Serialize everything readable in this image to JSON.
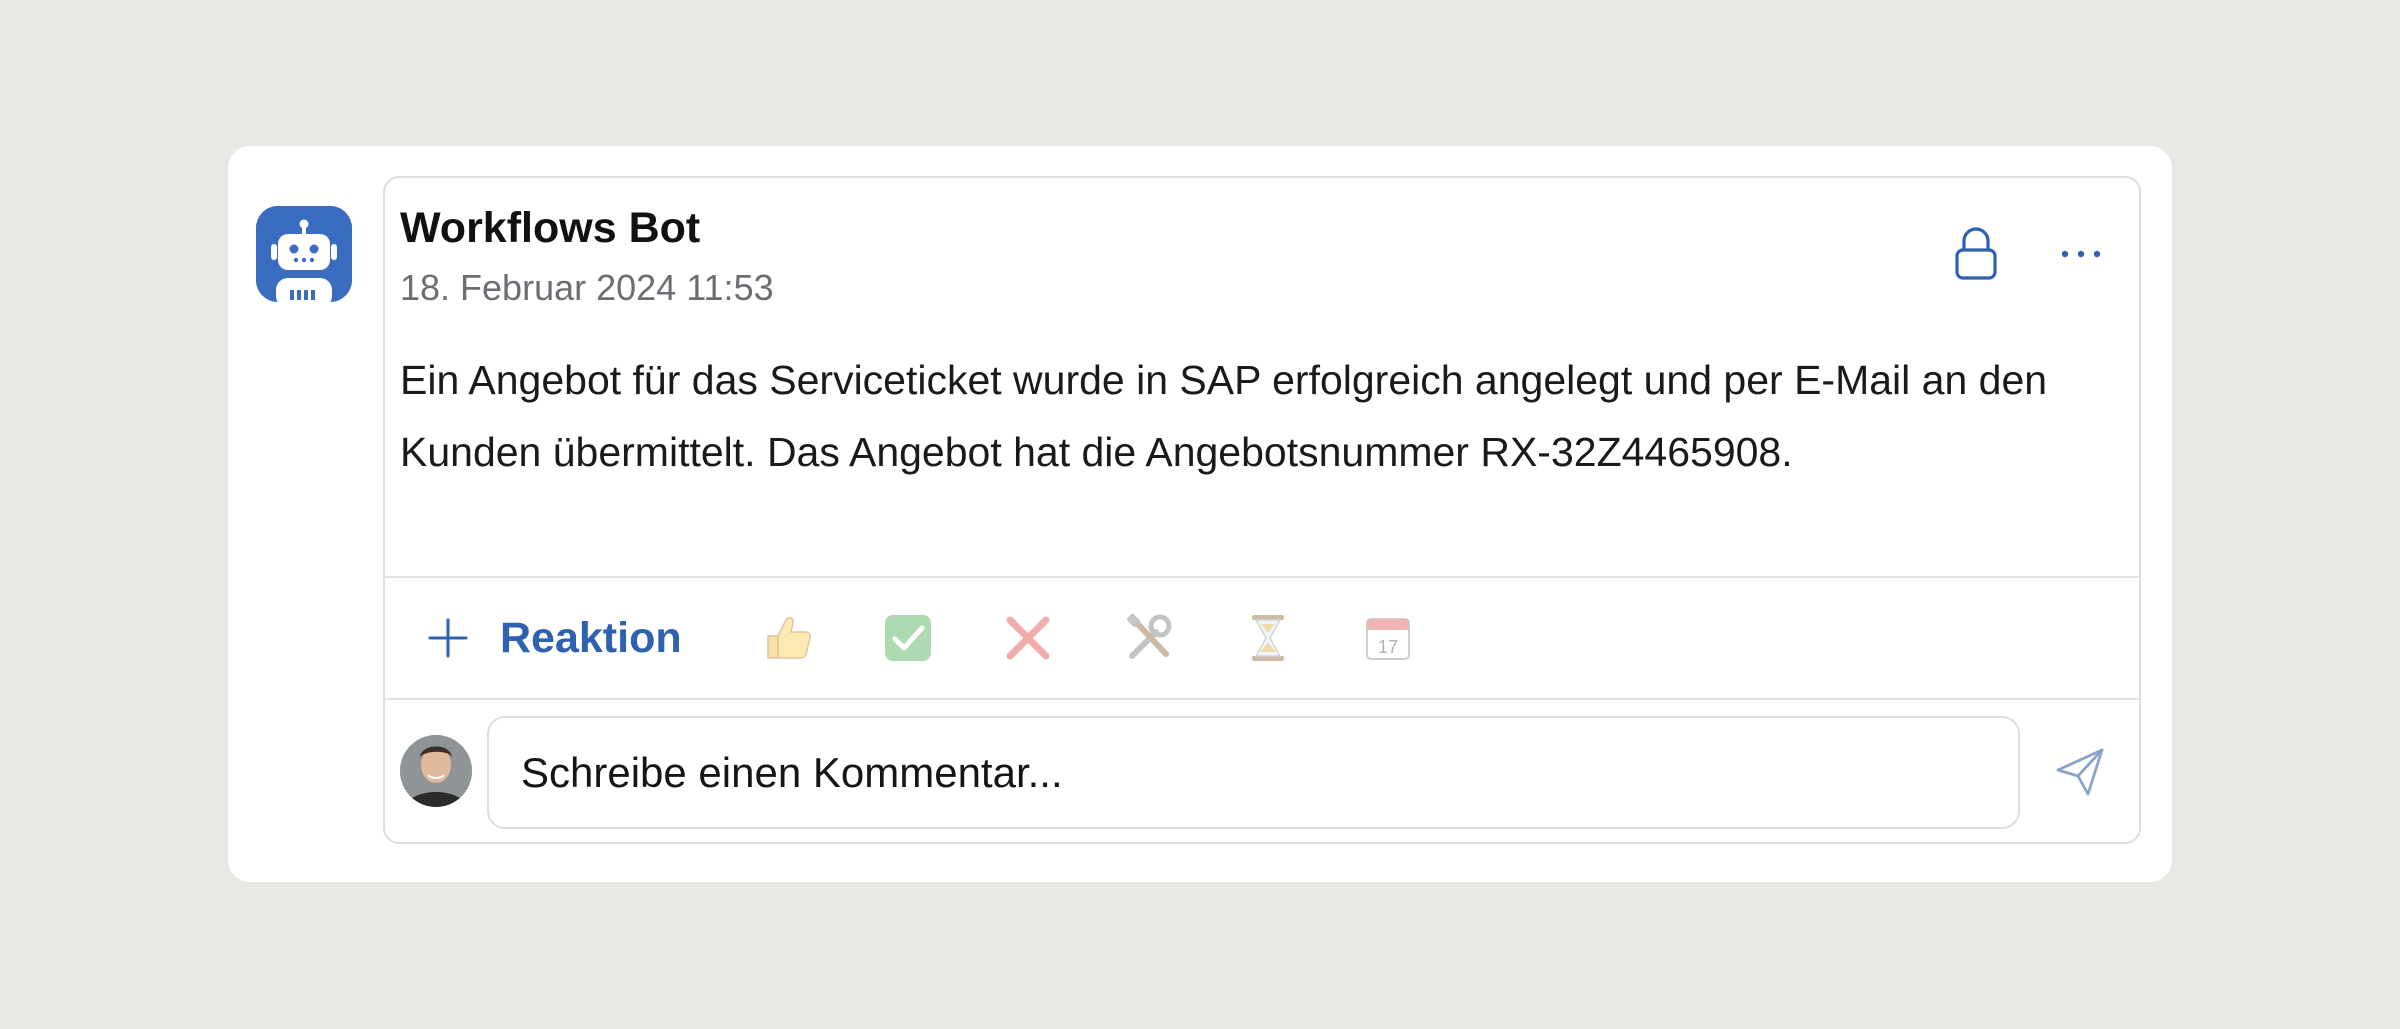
{
  "post": {
    "author": "Workflows Bot",
    "date": "18. Februar 2024 11:53",
    "message": "Ein Angebot für das Serviceticket wurde in SAP erfolgreich angelegt und per E-Mail an den Kunden übermittelt. Das Angebot hat die Angebotsnummer RX-32Z4465908."
  },
  "reactions": {
    "add_label": "Reaktion",
    "emojis": [
      "thumbs-up",
      "check-mark",
      "cross-mark",
      "tools",
      "hourglass",
      "calendar"
    ]
  },
  "comment": {
    "placeholder": "Schreibe einen Kommentar..."
  },
  "colors": {
    "accent": "#2e62b0",
    "bot_avatar": "#3a6dbf",
    "background": "#e6e8e3"
  },
  "icons": [
    "robot-icon",
    "lock-icon",
    "more-icon",
    "plus-icon",
    "send-icon"
  ]
}
